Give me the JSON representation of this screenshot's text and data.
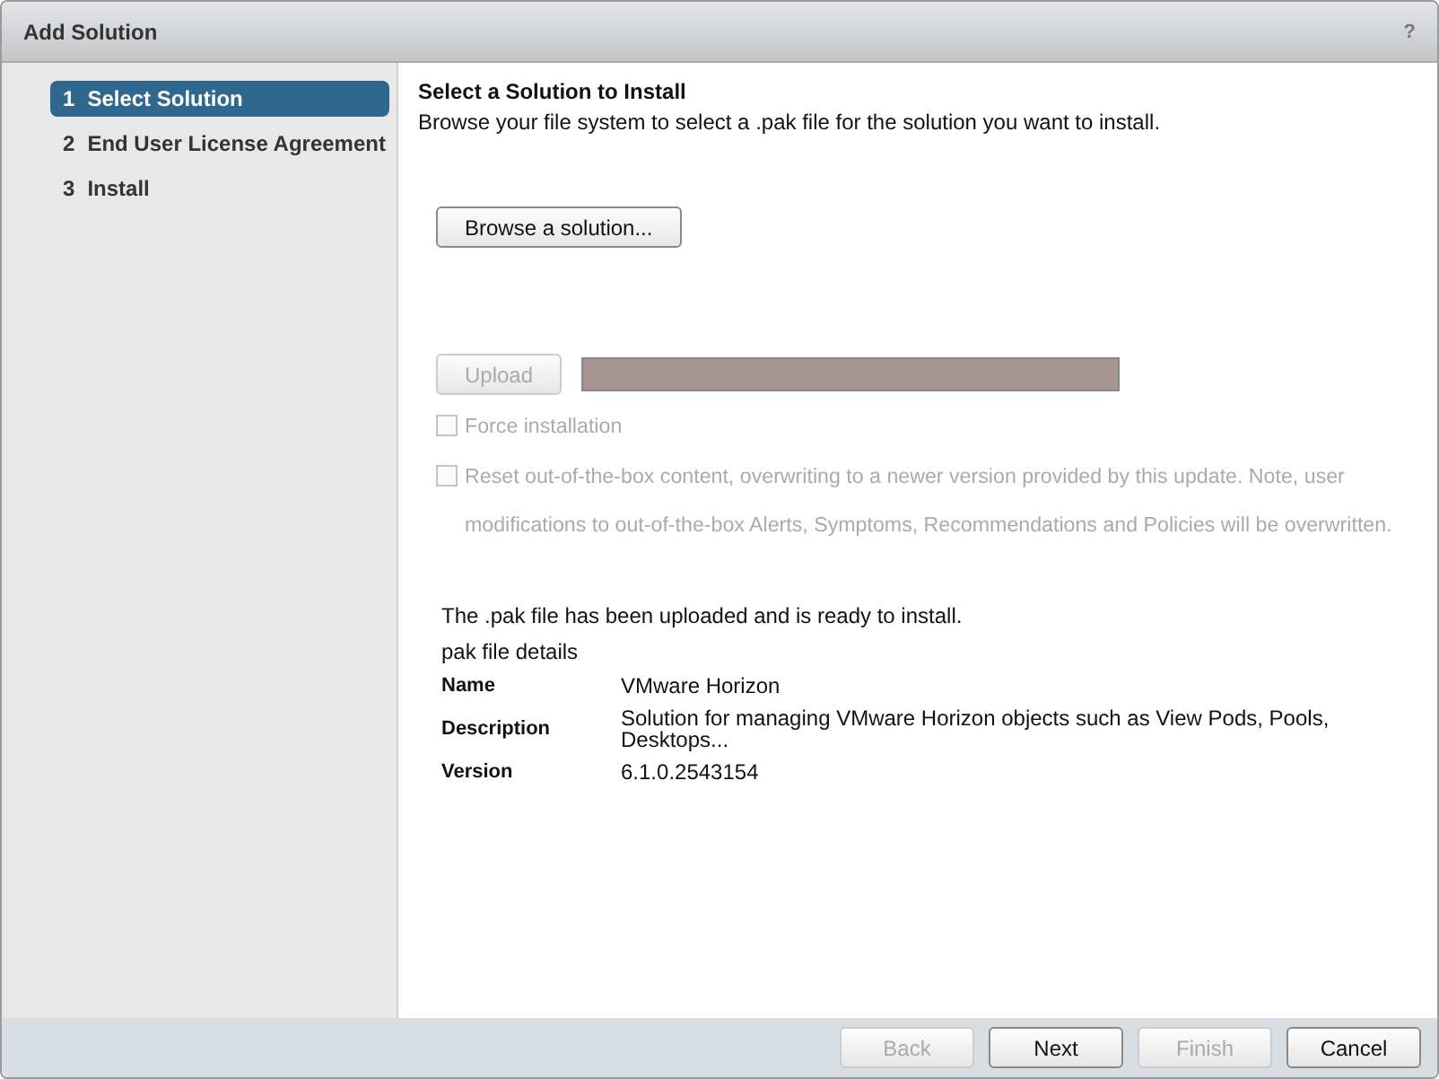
{
  "window": {
    "title": "Add Solution",
    "help": "?"
  },
  "steps": [
    {
      "number": "1",
      "label": "Select Solution",
      "selected": true
    },
    {
      "number": "2",
      "label": "End User License Agreement",
      "selected": false
    },
    {
      "number": "3",
      "label": "Install",
      "selected": false
    }
  ],
  "heading": "Select a Solution to Install",
  "instructions": "Browse your file system to select a .pak file for the solution you want to install.",
  "browse_button": {
    "label": "Browse a solution...",
    "disabled": false
  },
  "upload_button": {
    "label": "Upload",
    "disabled": true
  },
  "upload_progress": {
    "level": 1
  },
  "options": [
    {
      "label": "Force installation",
      "checked": false,
      "disabled": true
    },
    {
      "label": "Reset out-of-the-box content, overwriting to a newer version provided by this update. Note, user modifications to out-of-the-box Alerts, Symptoms, Recommendations and Policies will be overwritten.",
      "checked": false,
      "disabled": true
    }
  ],
  "status_message": "The .pak file has been uploaded and is ready to install.",
  "details_title": "pak file details",
  "details": [
    {
      "label": "Name",
      "value": "VMware Horizon"
    },
    {
      "label": "Description",
      "value": "Solution for managing VMware Horizon objects such as View Pods, Pools, Desktops..."
    },
    {
      "label": "Version",
      "value": "6.1.0.2543154"
    }
  ],
  "footer_buttons": [
    {
      "label": "Back",
      "disabled": true
    },
    {
      "label": "Next",
      "disabled": false
    },
    {
      "label": "Finish",
      "disabled": true
    },
    {
      "label": "Cancel",
      "disabled": false
    }
  ]
}
